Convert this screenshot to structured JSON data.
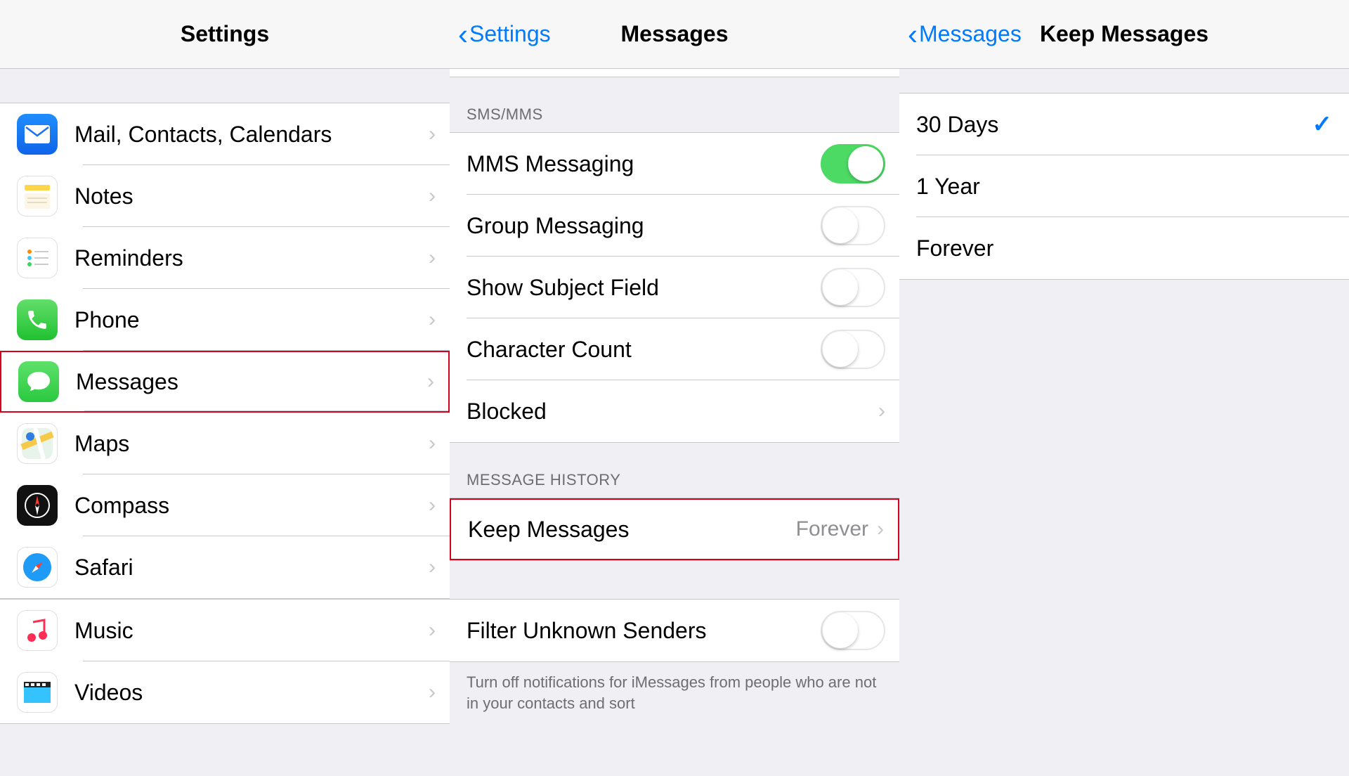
{
  "panel1": {
    "title": "Settings",
    "group1": [
      {
        "id": "mail",
        "label": "Mail, Contacts, Calendars",
        "icon": "mail-icon"
      },
      {
        "id": "notes",
        "label": "Notes",
        "icon": "notes-icon"
      },
      {
        "id": "remind",
        "label": "Reminders",
        "icon": "reminders-icon"
      },
      {
        "id": "phone",
        "label": "Phone",
        "icon": "phone-icon"
      },
      {
        "id": "messages",
        "label": "Messages",
        "icon": "messages-icon",
        "highlighted": true
      },
      {
        "id": "maps",
        "label": "Maps",
        "icon": "maps-icon"
      },
      {
        "id": "compass",
        "label": "Compass",
        "icon": "compass-icon"
      },
      {
        "id": "safari",
        "label": "Safari",
        "icon": "safari-icon"
      }
    ],
    "group2": [
      {
        "id": "music",
        "label": "Music",
        "icon": "music-icon"
      },
      {
        "id": "videos",
        "label": "Videos",
        "icon": "videos-icon"
      }
    ]
  },
  "panel2": {
    "back": "Settings",
    "title": "Messages",
    "section1_header": "SMS/MMS",
    "section1": [
      {
        "label": "MMS Messaging",
        "toggle": true
      },
      {
        "label": "Group Messaging",
        "toggle": false
      },
      {
        "label": "Show Subject Field",
        "toggle": false
      },
      {
        "label": "Character Count",
        "toggle": false
      },
      {
        "label": "Blocked",
        "nav": true
      }
    ],
    "section2_header": "MESSAGE HISTORY",
    "keep_label": "Keep Messages",
    "keep_value": "Forever",
    "section3": [
      {
        "label": "Filter Unknown Senders",
        "toggle": false
      }
    ],
    "footer": "Turn off notifications for iMessages from people who are not in your contacts and sort"
  },
  "panel3": {
    "back": "Messages",
    "title": "Keep Messages",
    "options": [
      {
        "label": "30 Days",
        "selected": true
      },
      {
        "label": "1 Year",
        "selected": false
      },
      {
        "label": "Forever",
        "selected": false
      }
    ]
  }
}
